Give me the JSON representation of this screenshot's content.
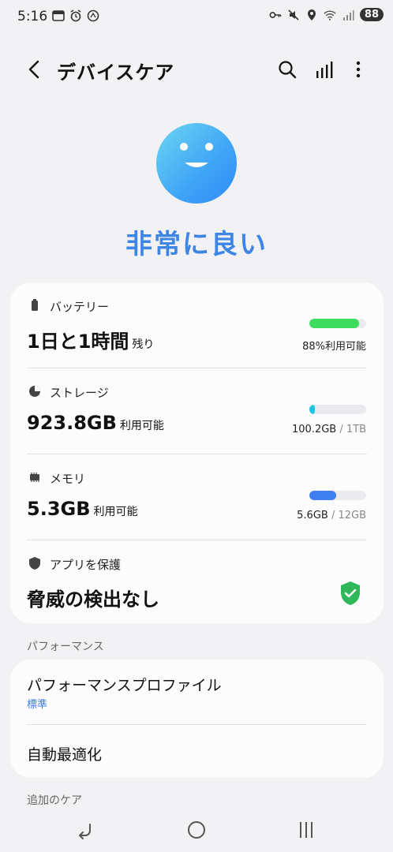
{
  "status_bar": {
    "time": "5:16",
    "battery": "88"
  },
  "header": {
    "title": "デバイスケア"
  },
  "device_status": {
    "label": "非常に良い",
    "accent_color": "#3d86e6"
  },
  "battery": {
    "label": "バッテリー",
    "value": "1日と1時間",
    "value_suffix": "残り",
    "detail": "88%利用可能",
    "bar_percent": 88,
    "bar_color": "#3ddc5f"
  },
  "storage": {
    "label": "ストレージ",
    "value": "923.8GB",
    "value_suffix": "利用可能",
    "used": "100.2GB",
    "total": " / 1TB",
    "bar_percent": 10,
    "bar_color": "#1cc3e2"
  },
  "memory": {
    "label": "メモリ",
    "value": "5.3GB",
    "value_suffix": "利用可能",
    "used": "5.6GB",
    "total": " / 12GB",
    "bar_percent": 47,
    "bar_color": "#3e7ef0"
  },
  "app_protection": {
    "label": "アプリを保護",
    "value": "脅威の検出なし",
    "shield_color": "#2fb85a"
  },
  "performance": {
    "section_title": "パフォーマンス",
    "profile_title": "パフォーマンスプロファイル",
    "profile_value": "標準",
    "auto_optimize": "自動最適化"
  },
  "additional_care": {
    "section_title": "追加のケア"
  }
}
